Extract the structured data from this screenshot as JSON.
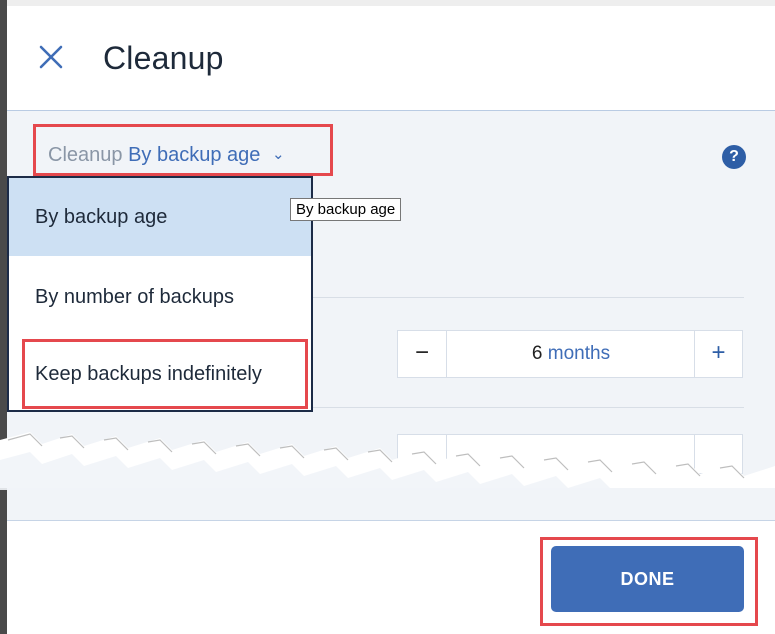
{
  "dialog": {
    "title": "Cleanup",
    "close_icon": "close-icon",
    "help_icon": "help-icon",
    "help_glyph": "?"
  },
  "cleanup_selector": {
    "prefix": "Cleanup",
    "value": "By backup age",
    "chevron": "⌄"
  },
  "dropdown": {
    "items": [
      {
        "label": "By backup age",
        "selected": true
      },
      {
        "label": "By number of backups",
        "selected": false
      },
      {
        "label": "Keep backups indefinitely",
        "selected": false
      }
    ]
  },
  "tooltip": {
    "text": "By backup age"
  },
  "stepper": {
    "minus": "−",
    "value_number": "6",
    "value_unit": "months",
    "plus": "+"
  },
  "footer": {
    "done_label": "DONE"
  },
  "colors": {
    "accent": "#3f6db7",
    "highlight": "#e5484d",
    "selected_item": "#cde0f3"
  }
}
